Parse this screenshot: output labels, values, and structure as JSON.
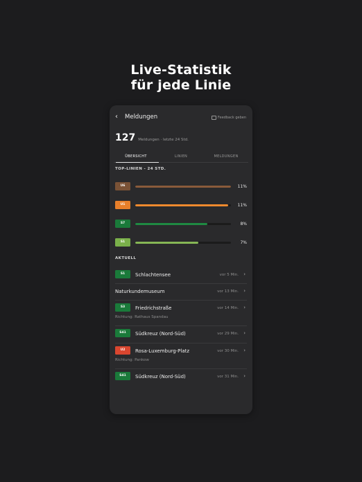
{
  "headline": {
    "line1": "Live-Statistik",
    "line2": "für jede Linie"
  },
  "topbar": {
    "back_icon": "chevron-left-icon",
    "title": "Meldungen",
    "feedback_label": "Feedback geben"
  },
  "summary": {
    "count": "127",
    "subtitle": "Meldungen · letzte 24 Std."
  },
  "tabs": [
    {
      "label": "ÜBERSICHT",
      "active": true
    },
    {
      "label": "LINIEN",
      "active": false
    },
    {
      "label": "MELDUNGEN",
      "active": false
    }
  ],
  "top_lines": {
    "heading": "TOP-LINIEN - 24 STD.",
    "items": [
      {
        "line": "U6",
        "color": "#7a5236",
        "fill": 1.0,
        "bar_color": "#8a5b3b",
        "pct": "11%"
      },
      {
        "line": "U1",
        "color": "#e87f2a",
        "fill": 0.97,
        "bar_color": "#f08a2e",
        "pct": "11%"
      },
      {
        "line": "S7",
        "color": "#1a7a3a",
        "fill": 0.75,
        "bar_color": "#1f8a42",
        "pct": "8%"
      },
      {
        "line": "S1",
        "color": "#7ab04a",
        "fill": 0.66,
        "bar_color": "#86b655",
        "pct": "7%"
      }
    ]
  },
  "current": {
    "heading": "AKTUELL",
    "items": [
      {
        "line": "S1",
        "color": "#1a7a3a",
        "name": "Schlachtensee",
        "time": "vor 5 Min.",
        "direction": ""
      },
      {
        "line": "",
        "color": "",
        "name": "Naturkundemuseum",
        "time": "vor 13 Min.",
        "direction": ""
      },
      {
        "line": "S3",
        "color": "#1a7a3a",
        "name": "Friedrichstraße",
        "time": "vor 14 Min.",
        "direction": "Richtung: Rathaus Spandau"
      },
      {
        "line": "S41",
        "color": "#1a7a3a",
        "name": "Südkreuz (Nord-Süd)",
        "time": "vor 29 Min.",
        "direction": ""
      },
      {
        "line": "U2",
        "color": "#d9462f",
        "name": "Rosa-Luxemburg-Platz",
        "time": "vor 30 Min.",
        "direction": "Richtung: Pankow"
      },
      {
        "line": "S41",
        "color": "#1a7a3a",
        "name": "Südkreuz (Nord-Süd)",
        "time": "vor 31 Min.",
        "direction": ""
      }
    ]
  }
}
